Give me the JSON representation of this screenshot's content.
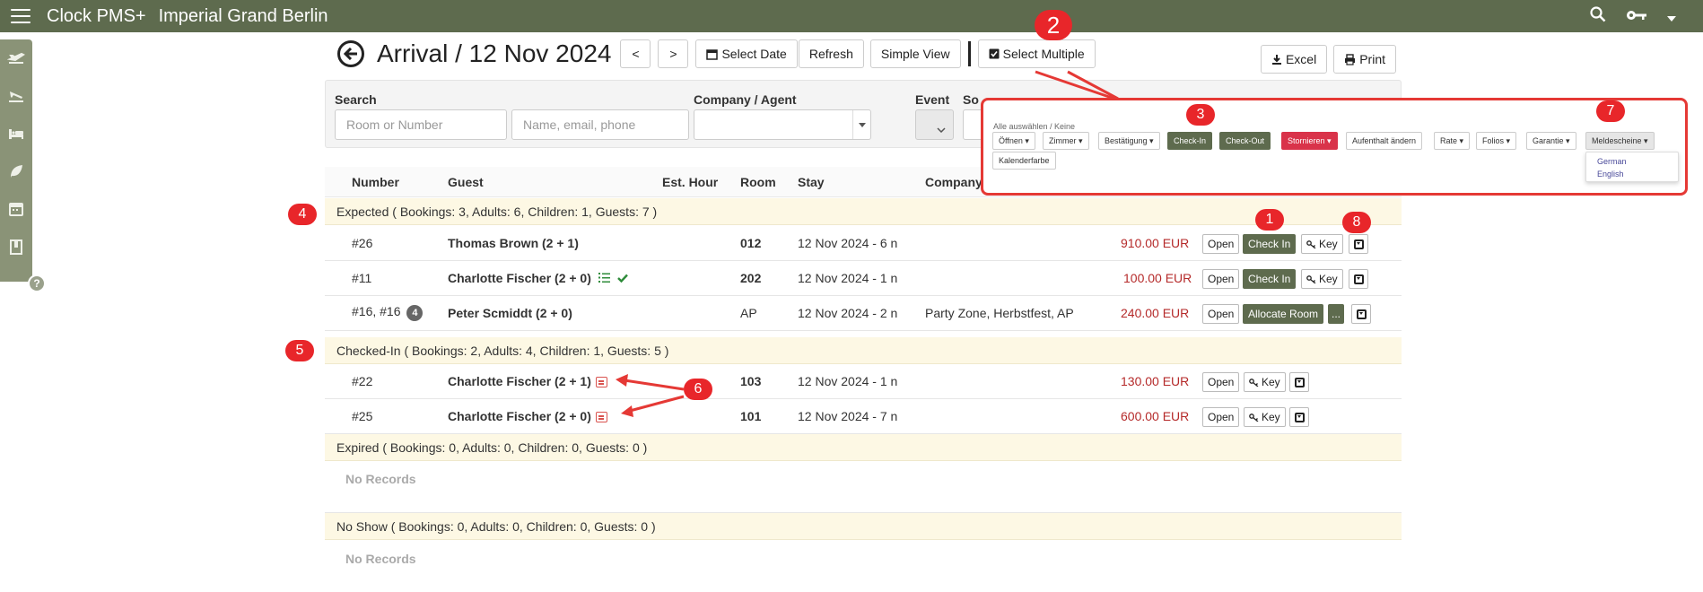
{
  "app": {
    "name": "Clock PMS+",
    "hotel": "Imperial Grand Berlin"
  },
  "header": {
    "title": "Arrival / 12 Nov 2024",
    "prev_label": "<",
    "next_label": ">",
    "select_date_label": "Select Date",
    "refresh_label": "Refresh",
    "simple_view_label": "Simple View",
    "select_multiple_label": "Select Multiple",
    "excel_label": "Excel",
    "print_label": "Print"
  },
  "filters": {
    "search_label": "Search",
    "room_placeholder": "Room or Number",
    "name_placeholder": "Name, email, phone",
    "company_label": "Company / Agent",
    "event_label": "Event",
    "sort_label": "So"
  },
  "columns": [
    "Number",
    "Guest",
    "Est. Hour",
    "Room",
    "Stay",
    "Company"
  ],
  "groups": {
    "expected": "Expected ( Bookings: 3, Adults: 6, Children: 1, Guests: 7 )",
    "checked_in": "Checked-In ( Bookings: 2, Adults: 4, Children: 1, Guests: 5 )",
    "expired": "Expired ( Bookings: 0, Adults: 0, Children: 0, Guests: 0 )",
    "no_show": "No Show ( Bookings: 0, Adults: 0, Children: 0, Guests: 0 )"
  },
  "no_records": "No Records",
  "expected_rows": [
    {
      "number": "#26",
      "guest": "Thomas Brown (2 + 1)",
      "room": "012",
      "stay": "12 Nov 2024 - 6 n",
      "company": "",
      "amount": "910.00 EUR"
    },
    {
      "number": "#11",
      "guest": "Charlotte Fischer (2 + 0)",
      "room": "202",
      "stay": "12 Nov 2024 - 1 n",
      "company": "",
      "amount": "100.00 EUR"
    },
    {
      "number": "#16, #16",
      "badge": "4",
      "guest": "Peter Scmiddt (2 + 0)",
      "room": "AP",
      "stay": "12 Nov 2024 - 2 n",
      "company": "Party Zone, Herbstfest, AP",
      "amount": "240.00 EUR"
    }
  ],
  "checked_in_rows": [
    {
      "number": "#22",
      "guest": "Charlotte Fischer (2 + 1)",
      "room": "103",
      "stay": "12 Nov 2024 - 1 n",
      "amount": "130.00 EUR"
    },
    {
      "number": "#25",
      "guest": "Charlotte Fischer (2 + 0)",
      "room": "101",
      "stay": "12 Nov 2024 - 7 n",
      "amount": "600.00 EUR"
    }
  ],
  "row_buttons": {
    "open": "Open",
    "check_in": "Check In",
    "key": "Key",
    "allocate": "Allocate Room",
    "more": "..."
  },
  "popup": {
    "label": "Alle auswählen / Keine",
    "buttons": [
      "Öffnen",
      "Zimmer",
      "Bestätigung",
      "Check-In",
      "Check-Out",
      "Stornieren",
      "Aufenthalt ändern",
      "Rate",
      "Folios",
      "Garantie",
      "Meldescheine",
      "Kalenderfarbe"
    ],
    "dropdown": [
      "German",
      "English"
    ]
  },
  "callouts": [
    "1",
    "2",
    "3",
    "4",
    "5",
    "6",
    "7",
    "8"
  ],
  "colors": {
    "brand": "#5e6b4e",
    "rail": "#8a9377",
    "amount": "#b52a2a",
    "callout": "#e8262a",
    "group_bg": "#fdf8e4"
  }
}
